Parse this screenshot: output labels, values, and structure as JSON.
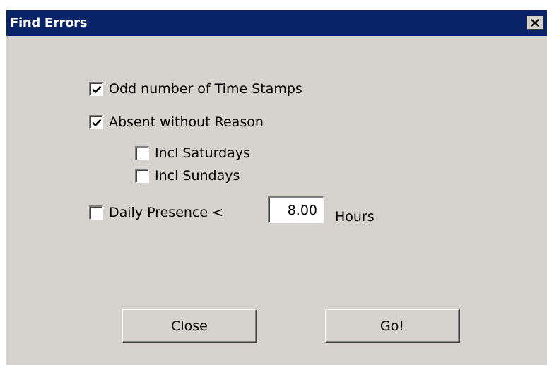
{
  "window": {
    "title": "Find Errors",
    "close_icon": "close-x-icon"
  },
  "options": {
    "odd_timestamps": {
      "label": "Odd number of Time Stamps",
      "checked": true
    },
    "absent_without_reason": {
      "label": "Absent without Reason",
      "checked": true
    },
    "incl_saturdays": {
      "label": "Incl Saturdays",
      "checked": false
    },
    "incl_sundays": {
      "label": "Incl Sundays",
      "checked": false
    },
    "daily_presence": {
      "label": "Daily Presence <",
      "checked": false
    }
  },
  "presence_hours": {
    "value": "8.00",
    "unit": "Hours"
  },
  "buttons": {
    "close": "Close",
    "go": "Go!"
  },
  "colors": {
    "titlebar": "#0a246a",
    "dialog_bg": "#d6d3ce"
  }
}
